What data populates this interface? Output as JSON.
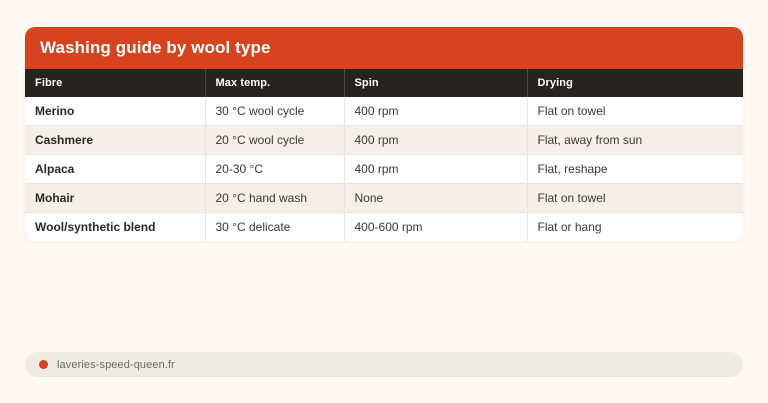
{
  "card": {
    "title": "Washing guide by wool type",
    "header_bg": "#d7431f",
    "title_color": "#ffffff"
  },
  "table": {
    "header_bg": "#272320",
    "zebra_row_bg": "#f4f0e9",
    "columns": [
      "Fibre",
      "Max temp.",
      "Spin",
      "Drying"
    ],
    "rows": [
      {
        "fibre": "Merino",
        "max_temp": "30 °C wool cycle",
        "spin": "400 rpm",
        "drying": "Flat on towel"
      },
      {
        "fibre": "Cashmere",
        "max_temp": "20 °C wool cycle",
        "spin": "400 rpm",
        "drying": "Flat, away from sun"
      },
      {
        "fibre": "Alpaca",
        "max_temp": "20-30 °C",
        "spin": "400 rpm",
        "drying": "Flat, reshape"
      },
      {
        "fibre": "Mohair",
        "max_temp": "20 °C hand wash",
        "spin": "None",
        "drying": "Flat on towel"
      },
      {
        "fibre": "Wool/synthetic blend",
        "max_temp": "30 °C delicate",
        "spin": "400-600 rpm",
        "drying": "Flat or hang"
      }
    ]
  },
  "footer": {
    "domain": "laveries-speed-queen.fr",
    "dot_color": "#d7431f"
  }
}
